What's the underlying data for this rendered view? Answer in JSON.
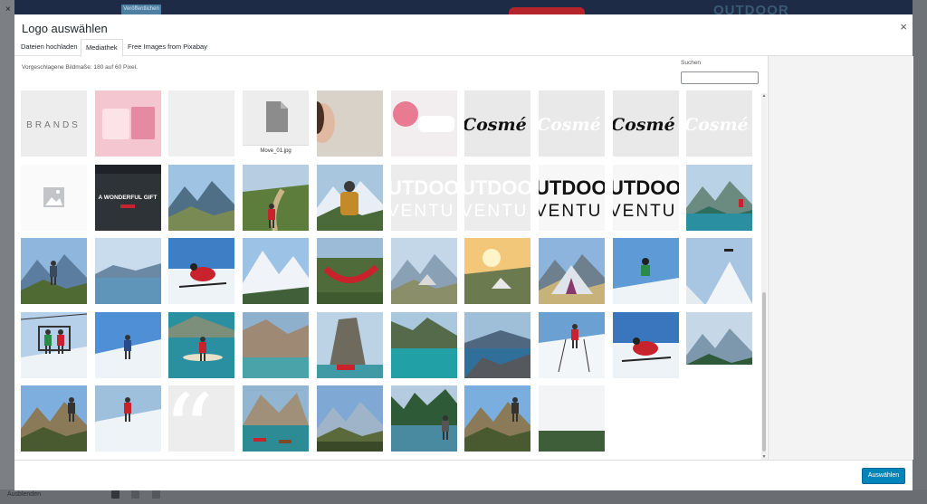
{
  "modal": {
    "title": "Logo auswählen",
    "close_label": "×",
    "tabs": [
      {
        "label": "Dateien hochladen"
      },
      {
        "label": "Mediathek"
      },
      {
        "label": "Free Images from Pixabay"
      }
    ],
    "hint": "Vorgeschlagene Bildmaße: 180 auf 60 Pixel.",
    "search": {
      "label": "Suchen",
      "value": "",
      "placeholder": ""
    },
    "select_button": "Auswählen"
  },
  "background": {
    "publish_button": "Veröffentlichen",
    "logo_text": "OUTDOOR",
    "close_glyph": "×",
    "bottom_text": "Ausblenden"
  },
  "library": {
    "file_name": "Move_01.jpg",
    "tiles": [
      {
        "name": "brands-logo",
        "label": "BRANDS"
      },
      {
        "name": "pink-cosmetics"
      },
      {
        "name": "blank"
      },
      {
        "name": "file-document"
      },
      {
        "name": "woman-face"
      },
      {
        "name": "pink-cream"
      },
      {
        "name": "cosme-dark",
        "label": "Cosmé"
      },
      {
        "name": "cosme-white",
        "label": "Cosmé"
      },
      {
        "name": "cosme-dark-2",
        "label": "Cosmé"
      },
      {
        "name": "cosme-white-2",
        "label": "Cosmé"
      },
      {
        "name": "placeholder-image"
      },
      {
        "name": "gift-web-banner",
        "label": "A WONDERFUL GIFT"
      },
      {
        "name": "mountain-hiker"
      },
      {
        "name": "trail-runner"
      },
      {
        "name": "backpack-hiker"
      },
      {
        "name": "outdoor-logo-white",
        "label1": "UTDOO",
        "label2": "VENTU"
      },
      {
        "name": "outdoor-logo-white-2",
        "label1": "UTDOO",
        "label2": "VENTU"
      },
      {
        "name": "outdoor-logo-black",
        "label1": "UTDOO",
        "label2": "VENTU"
      },
      {
        "name": "outdoor-logo-black-2",
        "label1": "UTDOO",
        "label2": "VENTU"
      },
      {
        "name": "mountain-lake-kayak"
      },
      {
        "name": "cyclist-mountains"
      },
      {
        "name": "lake-valley"
      },
      {
        "name": "skier-red"
      },
      {
        "name": "snowy-peaks"
      },
      {
        "name": "hammock-camp"
      },
      {
        "name": "tent-valley"
      },
      {
        "name": "sunset-tent"
      },
      {
        "name": "tent-mountain"
      },
      {
        "name": "jumping-skier"
      },
      {
        "name": "drone-snow"
      },
      {
        "name": "ski-lift"
      },
      {
        "name": "snow-climber"
      },
      {
        "name": "kayak-lake"
      },
      {
        "name": "dolomite-lake"
      },
      {
        "name": "rock-boat"
      },
      {
        "name": "turquoise-bay"
      },
      {
        "name": "fjord-rocks"
      },
      {
        "name": "skier-poles"
      },
      {
        "name": "skier-red-2"
      },
      {
        "name": "forest-valley"
      },
      {
        "name": "hiker-peak"
      },
      {
        "name": "skier-portrait"
      },
      {
        "name": "quote-marks"
      },
      {
        "name": "boats-lake"
      },
      {
        "name": "mountain-vista"
      },
      {
        "name": "river-hiker"
      },
      {
        "name": "hiker-peak-2"
      },
      {
        "name": "misty-forest"
      }
    ]
  },
  "colors": {
    "accent": "#0085ba",
    "sky": "#7ea9d6",
    "snow": "#eef3f8",
    "forest": "#3e6b3a",
    "lake": "#2a8fa0",
    "red": "#c8232c"
  }
}
